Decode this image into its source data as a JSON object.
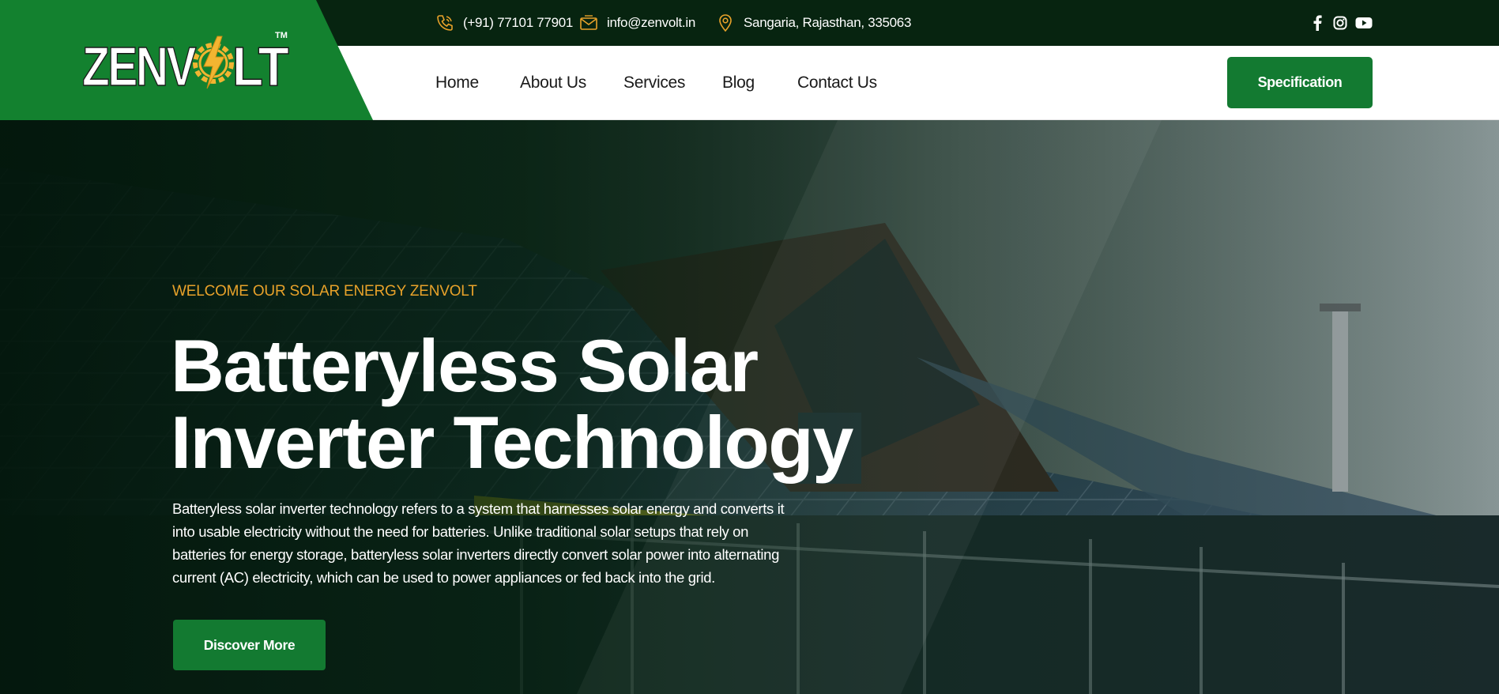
{
  "brand": {
    "logo_text": "ZENVOLT",
    "trademark": "TM"
  },
  "topbar": {
    "phone": "(+91) 77101 77901",
    "email": "info@zenvolt.in",
    "address": "Sangaria, Rajasthan, 335063",
    "icons": {
      "phone": "phone-icon",
      "email": "mail-icon",
      "address": "location-pin-icon"
    },
    "social": [
      "facebook-icon",
      "instagram-icon",
      "youtube-icon"
    ]
  },
  "nav": {
    "items": [
      {
        "label": "Home"
      },
      {
        "label": "About Us"
      },
      {
        "label": "Services"
      },
      {
        "label": "Blog"
      },
      {
        "label": "Contact Us"
      }
    ],
    "cta_label": "Specification"
  },
  "hero": {
    "eyebrow": "WELCOME OUR SOLAR ENERGY ZENVOLT",
    "headline_line1": "Batteryless Solar",
    "headline_line2": "Inverter Technology",
    "description": "Batteryless solar inverter technology refers to a system that harnesses solar energy and converts it into usable electricity without the need for batteries. Unlike traditional solar setups that rely on batteries for energy storage, batteryless solar inverters directly convert solar power into alternating current (AC) electricity, which can be used to power appliances or fed back into the grid.",
    "cta_label": "Discover More"
  },
  "colors": {
    "brand_green": "#13812f",
    "button_green": "#137a31",
    "topbar_bg": "#072410",
    "accent_orange": "#e8a22a"
  }
}
